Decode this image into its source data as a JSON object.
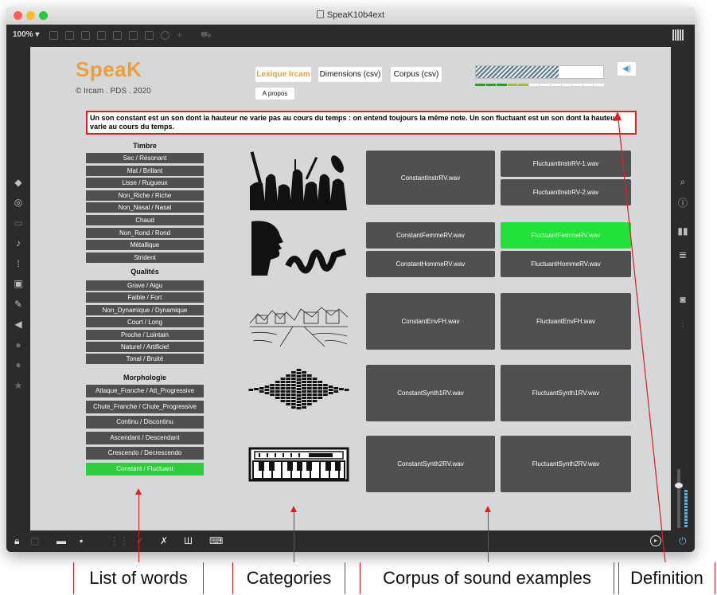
{
  "window": {
    "title": "SpeaK10b4ext"
  },
  "toolbar": {
    "zoom": "100%",
    "zoom_arrow": "▾"
  },
  "app": {
    "logo": "SpeaK",
    "copyright": "© Ircam . PDS . 2020",
    "buttons": {
      "lexique": "Lexique Ircam",
      "dimensions": "Dimensions (csv)",
      "corpus": "Corpus (csv)",
      "apropos": "A propos"
    },
    "level_meter": 0.65
  },
  "definition": "Un son constant est un son dont la hauteur ne varie pas au cours du temps : on entend toujours la même note. Un son fluctuant est un son dont la hauteur varie au cours du temps.",
  "words": {
    "timbre_title": "Timbre",
    "timbre": [
      "Sec / Résonant",
      "Mat / Brillant",
      "Lisse / Rugueux",
      "Non_Riche / Riche",
      "Non_Nasal / Nasal",
      "Chaud",
      "Non_Rond / Rond",
      "Métallique",
      "Strident"
    ],
    "qualites_title": "Qualités",
    "qualites": [
      "Grave / Aigu",
      "Faible / Fort",
      "Non_Dynamique / Dynamique",
      "Court / Long",
      "Proche / Lointain",
      "Naturel / Artificiel",
      "Tonal / Bruité"
    ],
    "morphologie_title": "Morphologie",
    "morphologie": [
      "Attaque_Franche / Att_Progressive",
      "Chute_Franche / Chute_Progressive",
      "Continu / Discontinu",
      "Ascendant / Descendant",
      "Crescendo / Decrescendo",
      "Constant / Fluctuant"
    ]
  },
  "sounds": {
    "constant": [
      "ConstantInstrRV.wav",
      "ConstantFemmeRV.wav",
      "ConstantHommeRV.wav",
      "ConstantEnvFH.wav",
      "ConstantSynth1RV.wav",
      "ConstantSynth2RV.wav"
    ],
    "fluctuant": [
      "FluctuantInstrRV-1.wav",
      "FluctuantInstrRV-2.wav",
      "FluctuantFemmeRV.wav",
      "FluctuantHommeRV.wav",
      "FluctuantEnvFH.wav",
      "FluctuantSynth1RV.wav",
      "FluctuantSynth2RV.wav"
    ]
  },
  "captions": {
    "words": "List of words",
    "categories": "Categories",
    "corpus": "Corpus of sound examples",
    "definition": "Definition"
  },
  "colors": {
    "accent": "#e8a040",
    "active": "#2ecc40",
    "annotation": "#e31b23",
    "button": "#505050"
  }
}
